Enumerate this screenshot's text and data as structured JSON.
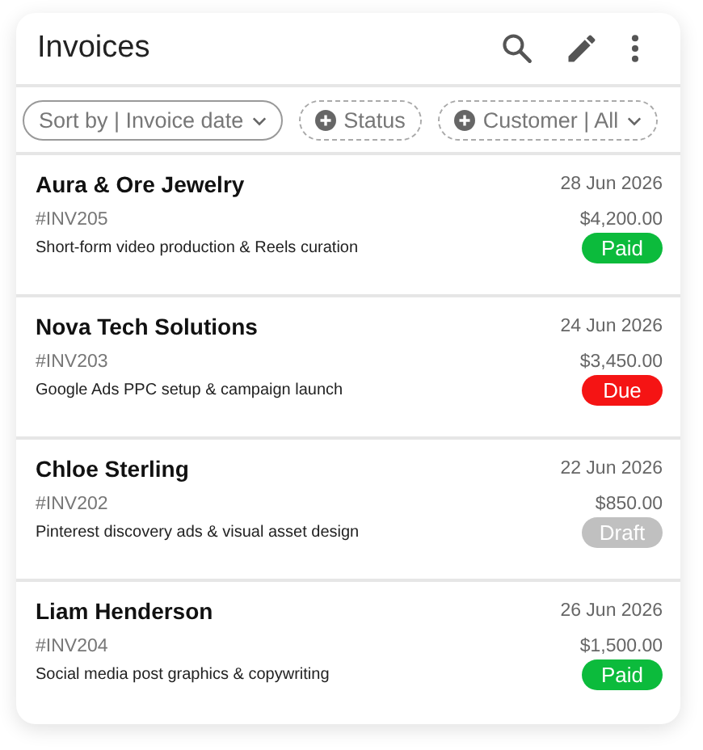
{
  "header": {
    "title": "Invoices"
  },
  "filters": [
    {
      "label": "Sort by | Invoice date",
      "kind": "sort",
      "dropdown": true
    },
    {
      "label": "Status",
      "kind": "add",
      "dropdown": false
    },
    {
      "label": "Customer | All",
      "kind": "add",
      "dropdown": true
    }
  ],
  "invoices": [
    {
      "customer": "Aura & Ore Jewelry",
      "date": "28 Jun 2026",
      "number": "#INV205",
      "amount": "$4,200.00",
      "description": "Short-form video production & Reels curation",
      "status": {
        "label": "Paid",
        "kind": "paid"
      }
    },
    {
      "customer": "Nova Tech Solutions",
      "date": "24 Jun 2026",
      "number": "#INV203",
      "amount": "$3,450.00",
      "description": "Google Ads PPC setup & campaign launch",
      "status": {
        "label": "Due",
        "kind": "due"
      }
    },
    {
      "customer": "Chloe Sterling",
      "date": "22 Jun 2026",
      "number": "#INV202",
      "amount": "$850.00",
      "description": "Pinterest discovery ads & visual asset design",
      "status": {
        "label": "Draft",
        "kind": "draft"
      }
    },
    {
      "customer": "Liam Henderson",
      "date": "26 Jun 2026",
      "number": "#INV204",
      "amount": "$1,500.00",
      "description": "Social media post graphics & copywriting",
      "status": {
        "label": "Paid",
        "kind": "paid"
      }
    }
  ]
}
